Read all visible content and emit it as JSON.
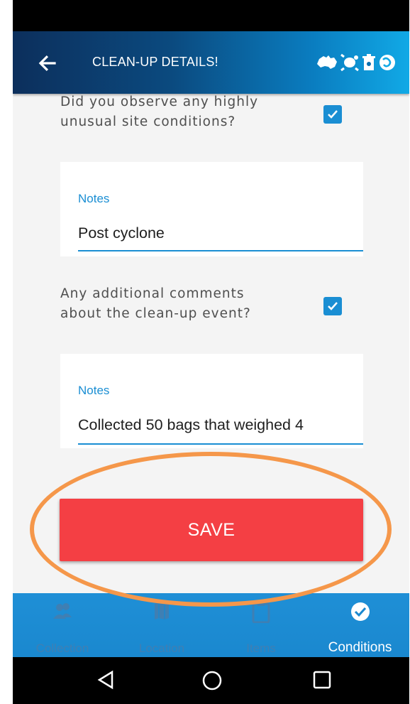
{
  "app_bar": {
    "title": "CLEAN-UP DETAILS!"
  },
  "questions": [
    {
      "text": "Did you observe any highly unusual site conditions?",
      "checked": true,
      "notes_label": "Notes",
      "notes_value": "Post cyclone"
    },
    {
      "text": "Any additional comments about the clean-up event?",
      "checked": true,
      "notes_label": "Notes",
      "notes_value": "Collected 50 bags that weighed 4"
    }
  ],
  "save_label": "SAVE",
  "bottom_nav": [
    {
      "label": "Collection",
      "icon": "people-icon",
      "active": false
    },
    {
      "label": "Location",
      "icon": "map-icon",
      "active": false
    },
    {
      "label": "Items",
      "icon": "clipboard-icon",
      "active": false
    },
    {
      "label": "Conditions",
      "icon": "check-circle-icon",
      "active": true
    }
  ],
  "colors": {
    "accent": "#1a8ed3",
    "save": "#f43f44",
    "highlight": "#f5974a",
    "appbar_start": "#0c2f5c",
    "appbar_end": "#11a9e6"
  }
}
